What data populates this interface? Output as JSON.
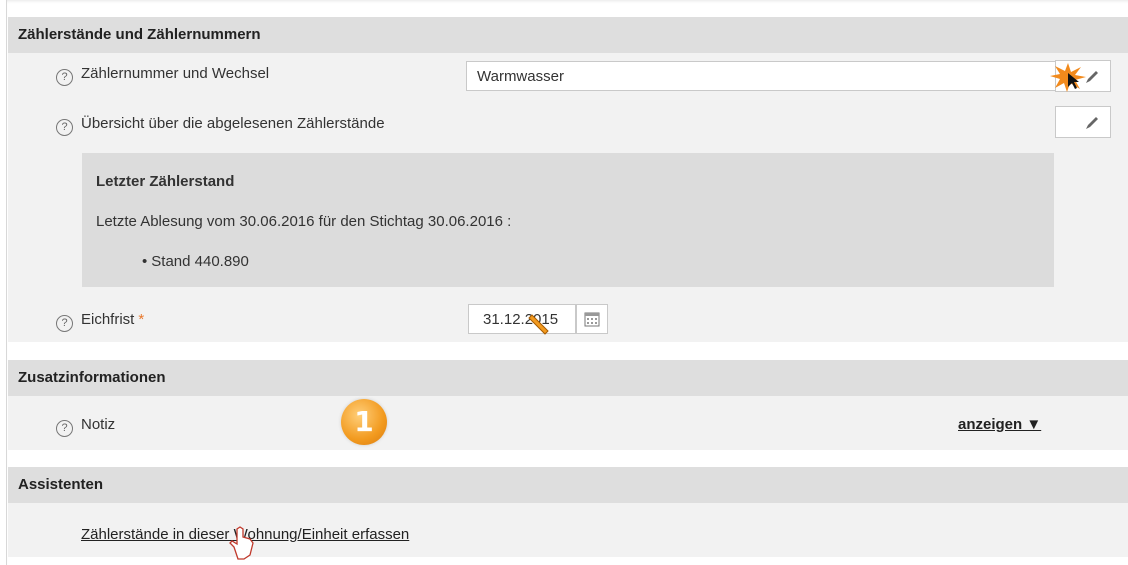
{
  "meter_section": {
    "title": "Zählerstände und Zählernummern",
    "meter_number": {
      "help": "?",
      "label": "Zählernummer und Wechsel",
      "value": "Warmwasser"
    },
    "overview": {
      "help": "?",
      "label": "Übersicht über die abgelesenen Zählerstände"
    },
    "last_reading": {
      "title": "Letzter Zählerstand",
      "text": "Letzte Ablesung vom 30.06.2016 für den Stichtag 30.06.2016 :",
      "item": "Stand 440.890"
    },
    "calibration": {
      "help": "?",
      "label": "Eichfrist",
      "required_mark": "*",
      "value": "31.12.2015"
    }
  },
  "additional_section": {
    "title": "Zusatzinformationen",
    "note": {
      "help": "?",
      "label": "Notiz",
      "show_link": "anzeigen ▼"
    },
    "step_badge": "1"
  },
  "assistants_section": {
    "title": "Assistenten",
    "link": "Zählerstände in dieser Wohnung/Einheit erfassen"
  },
  "icons": {
    "edit": "pencil-icon",
    "calendar": "calendar-icon",
    "help": "help-circle-icon",
    "cursor": "hand-pointer-icon"
  },
  "colors": {
    "required": "#e8782c",
    "badge": "#f29a1f",
    "header_bg": "#dedede",
    "section_bg": "#f2f2f2"
  }
}
